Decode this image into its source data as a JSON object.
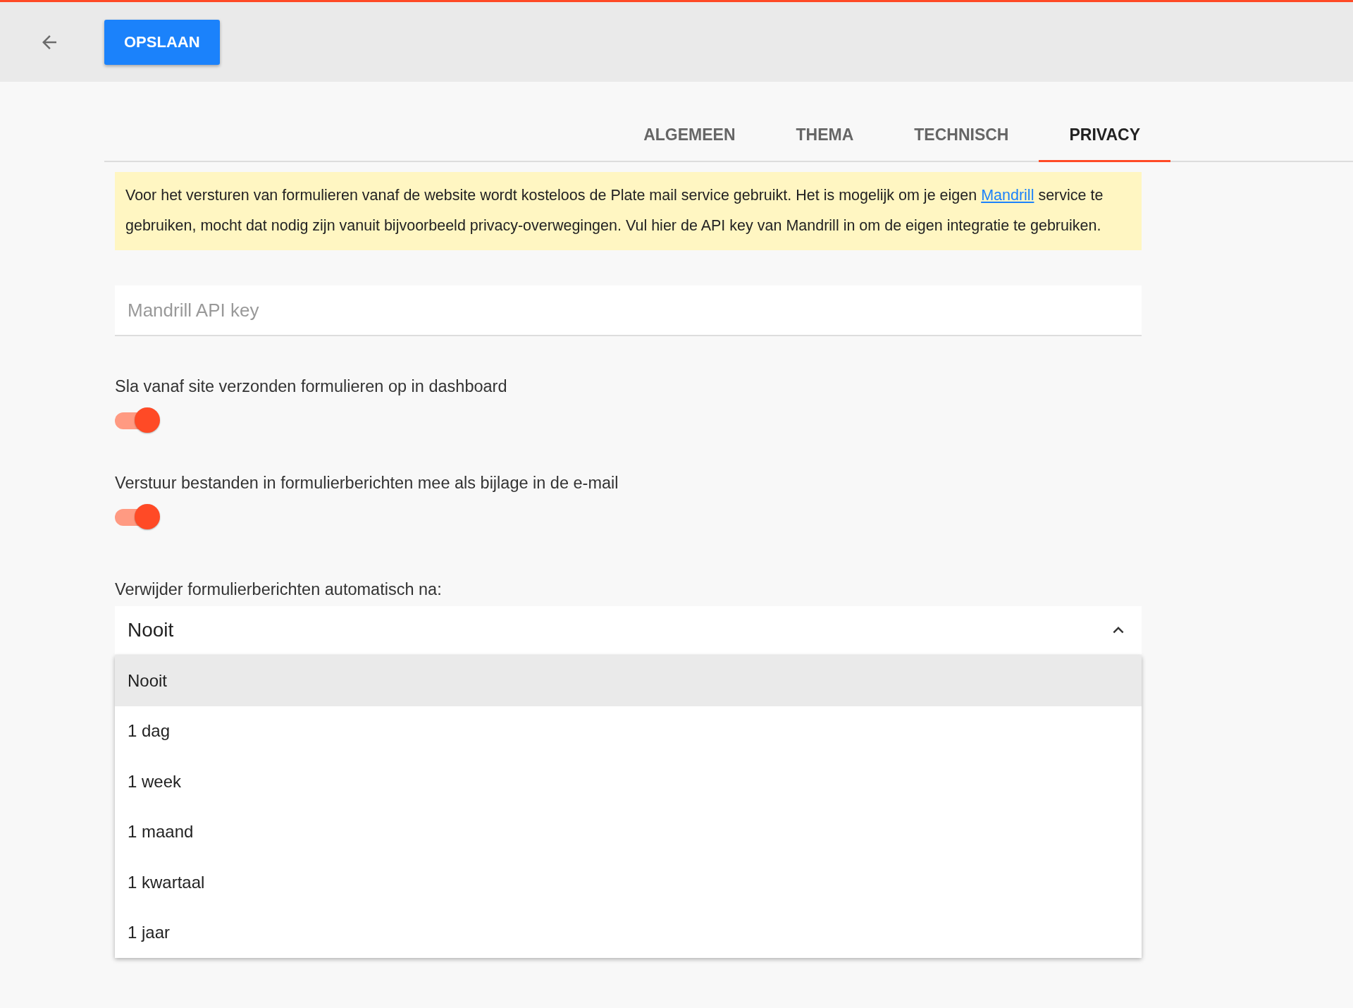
{
  "toolbar": {
    "save_button": "OPSLAAN"
  },
  "tabs": [
    {
      "label": "ALGEMEEN",
      "selected": false
    },
    {
      "label": "THEMA",
      "selected": false
    },
    {
      "label": "TECHNISCH",
      "selected": false
    },
    {
      "label": "PRIVACY",
      "selected": true
    }
  ],
  "notice": {
    "text_before": "Voor het versturen van formulieren vanaf de website wordt kosteloos de Plate mail service gebruikt. Het is mogelijk om je eigen",
    "link": "Mandrill",
    "text_after": "service te gebruiken, mocht dat nodig zijn vanuit bijvoorbeeld privacy-overwegingen. Vul hier de API key van Mandrill in om de eigen integratie te gebruiken."
  },
  "api_key_field": {
    "placeholder": "Mandrill API key"
  },
  "toggles": [
    {
      "label": "Sla vanaf site verzonden formulieren op in dashboard",
      "on": true
    },
    {
      "label": "Verstuur bestanden in formulierberichten mee als bijlage in de e-mail",
      "on": true
    }
  ],
  "delete_after": {
    "label": "Verwijder formulierberichten automatisch na:",
    "value": "Nooit",
    "expanded": true,
    "options": [
      {
        "label": "Nooit",
        "selected": true
      },
      {
        "label": "1 dag",
        "selected": false
      },
      {
        "label": "1 week",
        "selected": false
      },
      {
        "label": "1 maand",
        "selected": false
      },
      {
        "label": "1 kwartaal",
        "selected": false
      },
      {
        "label": "1 jaar",
        "selected": false
      }
    ]
  }
}
